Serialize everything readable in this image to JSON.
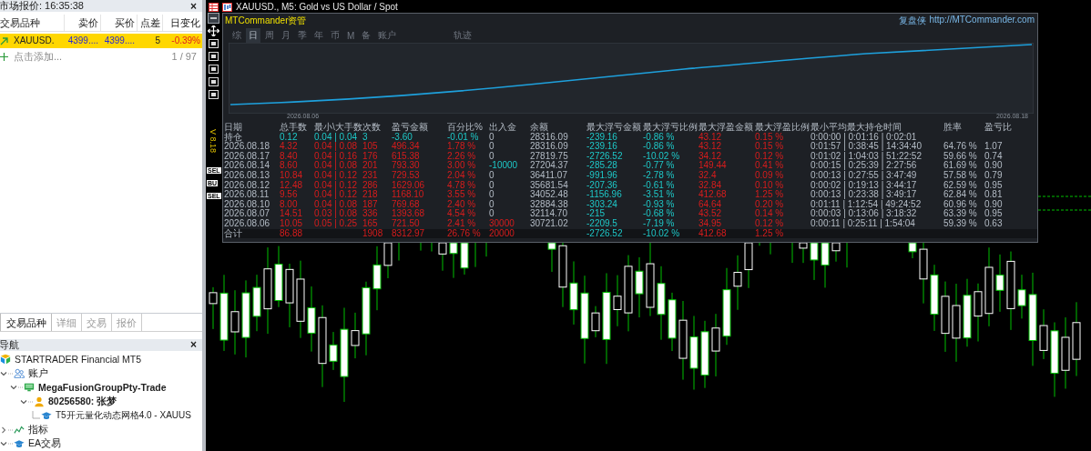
{
  "market_watch": {
    "title": "市场报价: 16:35:38",
    "close_label": "×",
    "columns": [
      "交易品种",
      "卖价",
      "买价",
      "点差",
      "日变化"
    ],
    "rows": [
      {
        "symbol": "XAUUSD.",
        "bid": "4399....",
        "ask": "4399....",
        "spread": "5",
        "change": "-0.39%",
        "selected": true
      }
    ],
    "add_hint": "点击添加...",
    "count": "1 / 97"
  },
  "left_tabs": [
    {
      "label": "交易品种",
      "selected": true
    },
    {
      "label": "详细",
      "selected": false
    },
    {
      "label": "交易",
      "selected": false
    },
    {
      "label": "报价",
      "selected": false
    }
  ],
  "navigator": {
    "title": "导航",
    "close_label": "×",
    "tree": [
      {
        "label": "STARTRADER Financial MT5",
        "kind": "broker"
      },
      {
        "label": "账户",
        "kind": "accounts",
        "expanded": true,
        "children": [
          {
            "label": "MegaFusionGroupPty-Trade",
            "kind": "server",
            "expanded": true,
            "children": [
              {
                "label": "80256580: 张梦",
                "kind": "account",
                "expanded": true,
                "children": [
                  {
                    "label": "T5开元量化动态网格4.0 - XAUUS",
                    "kind": "expert"
                  }
                ]
              }
            ]
          }
        ]
      },
      {
        "label": "指标",
        "kind": "indicators",
        "expanded": false
      },
      {
        "label": "EA交易",
        "kind": "experts",
        "expanded": true
      }
    ]
  },
  "chart": {
    "title": "XAUUSD., M5:  Gold vs US Dollar / Spot",
    "version": "V 8.18",
    "side_labels": [
      "SEL",
      "BU",
      "SEL"
    ]
  },
  "commander": {
    "title": "MTCommander资管",
    "brand": "复盘侠",
    "url": "http://MTCommander.com",
    "tabs": [
      {
        "label": "综",
        "kind": "period",
        "selected": false
      },
      {
        "label": "日",
        "kind": "period",
        "selected": true
      },
      {
        "label": "周",
        "kind": "period",
        "selected": false
      },
      {
        "label": "月",
        "kind": "period",
        "selected": false
      },
      {
        "label": "季",
        "kind": "period",
        "selected": false
      },
      {
        "label": "年",
        "kind": "period",
        "selected": false
      },
      {
        "label": "币",
        "kind": "period",
        "selected": false
      },
      {
        "label": "M",
        "kind": "period",
        "selected": false
      },
      {
        "label": "备",
        "kind": "period",
        "selected": false
      },
      {
        "label": "账户",
        "kind": "period",
        "selected": false
      },
      {
        "label": "轨迹",
        "kind": "view",
        "selected": false
      }
    ],
    "equity": {
      "start_label": "2026.08.06",
      "end_label": "2026.08.18"
    },
    "table": {
      "columns": [
        "日期",
        "总手数",
        "最小\\大手数",
        "次数",
        "盈亏金额",
        "百分比%",
        "出入金",
        "余额",
        "最大浮亏金额",
        "最大浮亏比例",
        "最大浮盈金额",
        "最大浮盈比例",
        "最小平均最大持仓时间",
        "胜率",
        "盈亏比"
      ],
      "rows": [
        {
          "kind": "position",
          "cells": [
            {
              "text": "持仓",
              "kind": "plain"
            },
            {
              "text": "0.12",
              "kind": "down"
            },
            {
              "text": "0.04 | 0.04",
              "kind": "down"
            },
            {
              "text": "3",
              "kind": "down"
            },
            {
              "text": "-3.60",
              "kind": "down"
            },
            {
              "text": "-0.01 %",
              "kind": "down"
            },
            {
              "text": "0",
              "kind": "plain"
            },
            {
              "text": "28316.09",
              "kind": "plain"
            },
            {
              "text": "-239.16",
              "kind": "down"
            },
            {
              "text": "-0.86 %",
              "kind": "down"
            },
            {
              "text": "43.12",
              "kind": "up"
            },
            {
              "text": "0.15 %",
              "kind": "up"
            },
            {
              "text": "0:00:00 | 0:01:16 | 0:02:01",
              "kind": "plain"
            }
          ]
        },
        {
          "kind": "day",
          "cells": [
            {
              "text": "2026.08.18",
              "kind": "plain"
            },
            {
              "text": "4.32",
              "kind": "up"
            },
            {
              "text": "0.04 | 0.08",
              "kind": "up"
            },
            {
              "text": "105",
              "kind": "up"
            },
            {
              "text": "496.34",
              "kind": "up"
            },
            {
              "text": "1.78 %",
              "kind": "up"
            },
            {
              "text": "0",
              "kind": "plain"
            },
            {
              "text": "28316.09",
              "kind": "plain"
            },
            {
              "text": "-239.16",
              "kind": "down"
            },
            {
              "text": "-0.86 %",
              "kind": "down"
            },
            {
              "text": "43.12",
              "kind": "up"
            },
            {
              "text": "0.15 %",
              "kind": "up"
            },
            {
              "text": "0:01:57 | 0:38:45 | 14:34:40",
              "kind": "plain"
            },
            {
              "text": "64.76 %",
              "kind": "plain"
            },
            {
              "text": "1.07",
              "kind": "plain"
            }
          ]
        },
        {
          "kind": "day",
          "cells": [
            {
              "text": "2026.08.17",
              "kind": "plain"
            },
            {
              "text": "8.40",
              "kind": "up"
            },
            {
              "text": "0.04 | 0.16",
              "kind": "up"
            },
            {
              "text": "176",
              "kind": "up"
            },
            {
              "text": "615.38",
              "kind": "up"
            },
            {
              "text": "2.26 %",
              "kind": "up"
            },
            {
              "text": "0",
              "kind": "plain"
            },
            {
              "text": "27819.75",
              "kind": "plain"
            },
            {
              "text": "-2726.52",
              "kind": "down"
            },
            {
              "text": "-10.02 %",
              "kind": "down"
            },
            {
              "text": "34.12",
              "kind": "up"
            },
            {
              "text": "0.12 %",
              "kind": "up"
            },
            {
              "text": "0:01:02 | 1:04:03 | 51:22:52",
              "kind": "plain"
            },
            {
              "text": "59.66 %",
              "kind": "plain"
            },
            {
              "text": "0.74",
              "kind": "plain"
            }
          ]
        },
        {
          "kind": "day",
          "cells": [
            {
              "text": "2026.08.14",
              "kind": "plain"
            },
            {
              "text": "8.60",
              "kind": "up"
            },
            {
              "text": "0.04 | 0.08",
              "kind": "up"
            },
            {
              "text": "201",
              "kind": "up"
            },
            {
              "text": "793.30",
              "kind": "up"
            },
            {
              "text": "3.00 %",
              "kind": "up"
            },
            {
              "text": "-10000",
              "kind": "down"
            },
            {
              "text": "27204.37",
              "kind": "plain"
            },
            {
              "text": "-285.28",
              "kind": "down"
            },
            {
              "text": "-0.77 %",
              "kind": "down"
            },
            {
              "text": "149.44",
              "kind": "up"
            },
            {
              "text": "0.41 %",
              "kind": "up"
            },
            {
              "text": "0:00:15 | 0:25:39 | 2:27:56",
              "kind": "plain"
            },
            {
              "text": "61.69 %",
              "kind": "plain"
            },
            {
              "text": "0.90",
              "kind": "plain"
            }
          ]
        },
        {
          "kind": "day",
          "cells": [
            {
              "text": "2026.08.13",
              "kind": "plain"
            },
            {
              "text": "10.84",
              "kind": "up"
            },
            {
              "text": "0.04 | 0.12",
              "kind": "up"
            },
            {
              "text": "231",
              "kind": "up"
            },
            {
              "text": "729.53",
              "kind": "up"
            },
            {
              "text": "2.04 %",
              "kind": "up"
            },
            {
              "text": "0",
              "kind": "plain"
            },
            {
              "text": "36411.07",
              "kind": "plain"
            },
            {
              "text": "-991.96",
              "kind": "down"
            },
            {
              "text": "-2.78 %",
              "kind": "down"
            },
            {
              "text": "32.4",
              "kind": "up"
            },
            {
              "text": "0.09 %",
              "kind": "up"
            },
            {
              "text": "0:00:13 | 0:27:55 | 3:47:49",
              "kind": "plain"
            },
            {
              "text": "57.58 %",
              "kind": "plain"
            },
            {
              "text": "0.79",
              "kind": "plain"
            }
          ]
        },
        {
          "kind": "day",
          "cells": [
            {
              "text": "2026.08.12",
              "kind": "plain"
            },
            {
              "text": "12.48",
              "kind": "up"
            },
            {
              "text": "0.04 | 0.12",
              "kind": "up"
            },
            {
              "text": "286",
              "kind": "up"
            },
            {
              "text": "1629.06",
              "kind": "up"
            },
            {
              "text": "4.78 %",
              "kind": "up"
            },
            {
              "text": "0",
              "kind": "plain"
            },
            {
              "text": "35681.54",
              "kind": "plain"
            },
            {
              "text": "-207.36",
              "kind": "down"
            },
            {
              "text": "-0.61 %",
              "kind": "down"
            },
            {
              "text": "32.84",
              "kind": "up"
            },
            {
              "text": "0.10 %",
              "kind": "up"
            },
            {
              "text": "0:00:02 | 0:19:13 | 3:44:17",
              "kind": "plain"
            },
            {
              "text": "62.59 %",
              "kind": "plain"
            },
            {
              "text": "0.95",
              "kind": "plain"
            }
          ]
        },
        {
          "kind": "day",
          "cells": [
            {
              "text": "2026.08.11",
              "kind": "plain"
            },
            {
              "text": "9.56",
              "kind": "up"
            },
            {
              "text": "0.04 | 0.12",
              "kind": "up"
            },
            {
              "text": "218",
              "kind": "up"
            },
            {
              "text": "1168.10",
              "kind": "up"
            },
            {
              "text": "3.55 %",
              "kind": "up"
            },
            {
              "text": "0",
              "kind": "plain"
            },
            {
              "text": "34052.48",
              "kind": "plain"
            },
            {
              "text": "-1156.96",
              "kind": "down"
            },
            {
              "text": "-3.51 %",
              "kind": "down"
            },
            {
              "text": "412.68",
              "kind": "up"
            },
            {
              "text": "1.25 %",
              "kind": "up"
            },
            {
              "text": "0:00:13 | 0:23:38 | 3:49:17",
              "kind": "plain"
            },
            {
              "text": "62.84 %",
              "kind": "plain"
            },
            {
              "text": "0.81",
              "kind": "plain"
            }
          ]
        },
        {
          "kind": "day",
          "cells": [
            {
              "text": "2026.08.10",
              "kind": "plain"
            },
            {
              "text": "8.00",
              "kind": "up"
            },
            {
              "text": "0.04 | 0.08",
              "kind": "up"
            },
            {
              "text": "187",
              "kind": "up"
            },
            {
              "text": "769.68",
              "kind": "up"
            },
            {
              "text": "2.40 %",
              "kind": "up"
            },
            {
              "text": "0",
              "kind": "plain"
            },
            {
              "text": "32884.38",
              "kind": "plain"
            },
            {
              "text": "-303.24",
              "kind": "down"
            },
            {
              "text": "-0.93 %",
              "kind": "down"
            },
            {
              "text": "64.64",
              "kind": "up"
            },
            {
              "text": "0.20 %",
              "kind": "up"
            },
            {
              "text": "0:01:11 | 1:12:54 | 49:24:52",
              "kind": "plain"
            },
            {
              "text": "60.96 %",
              "kind": "plain"
            },
            {
              "text": "0.90",
              "kind": "plain"
            }
          ]
        },
        {
          "kind": "day",
          "cells": [
            {
              "text": "2026.08.07",
              "kind": "plain"
            },
            {
              "text": "14.51",
              "kind": "up"
            },
            {
              "text": "0.03 | 0.08",
              "kind": "up"
            },
            {
              "text": "336",
              "kind": "up"
            },
            {
              "text": "1393.68",
              "kind": "up"
            },
            {
              "text": "4.54 %",
              "kind": "up"
            },
            {
              "text": "0",
              "kind": "plain"
            },
            {
              "text": "32114.70",
              "kind": "plain"
            },
            {
              "text": "-215",
              "kind": "down"
            },
            {
              "text": "-0.68 %",
              "kind": "down"
            },
            {
              "text": "43.52",
              "kind": "up"
            },
            {
              "text": "0.14 %",
              "kind": "up"
            },
            {
              "text": "0:00:03 | 0:13:06 | 3:18:32",
              "kind": "plain"
            },
            {
              "text": "63.39 %",
              "kind": "plain"
            },
            {
              "text": "0.95",
              "kind": "plain"
            }
          ]
        },
        {
          "kind": "day",
          "cells": [
            {
              "text": "2026.08.06",
              "kind": "plain"
            },
            {
              "text": "10.05",
              "kind": "up"
            },
            {
              "text": "0.05 | 0.25",
              "kind": "up"
            },
            {
              "text": "165",
              "kind": "up"
            },
            {
              "text": "721.50",
              "kind": "up"
            },
            {
              "text": "2.41 %",
              "kind": "up"
            },
            {
              "text": "30000",
              "kind": "up"
            },
            {
              "text": "30721.02",
              "kind": "plain"
            },
            {
              "text": "-2209.5",
              "kind": "down"
            },
            {
              "text": "-7.19 %",
              "kind": "down"
            },
            {
              "text": "34.95",
              "kind": "up"
            },
            {
              "text": "0.12 %",
              "kind": "up"
            },
            {
              "text": "0:00:11 | 0:25:11 | 1:54:04",
              "kind": "plain"
            },
            {
              "text": "59.39 %",
              "kind": "plain"
            },
            {
              "text": "0.63",
              "kind": "plain"
            }
          ]
        },
        {
          "kind": "total",
          "cells": [
            {
              "text": "合计",
              "kind": "plain"
            },
            {
              "text": "86.88",
              "kind": "up"
            },
            null,
            {
              "text": "1908",
              "kind": "up"
            },
            {
              "text": "8312.97",
              "kind": "up"
            },
            {
              "text": "26.76 %",
              "kind": "up"
            },
            {
              "text": "20000",
              "kind": "up"
            },
            null,
            {
              "text": "-2726.52",
              "kind": "down"
            },
            {
              "text": "-10.02 %",
              "kind": "down"
            },
            {
              "text": "412.68",
              "kind": "up"
            },
            {
              "text": "1.25 %",
              "kind": "up"
            }
          ]
        }
      ]
    }
  }
}
